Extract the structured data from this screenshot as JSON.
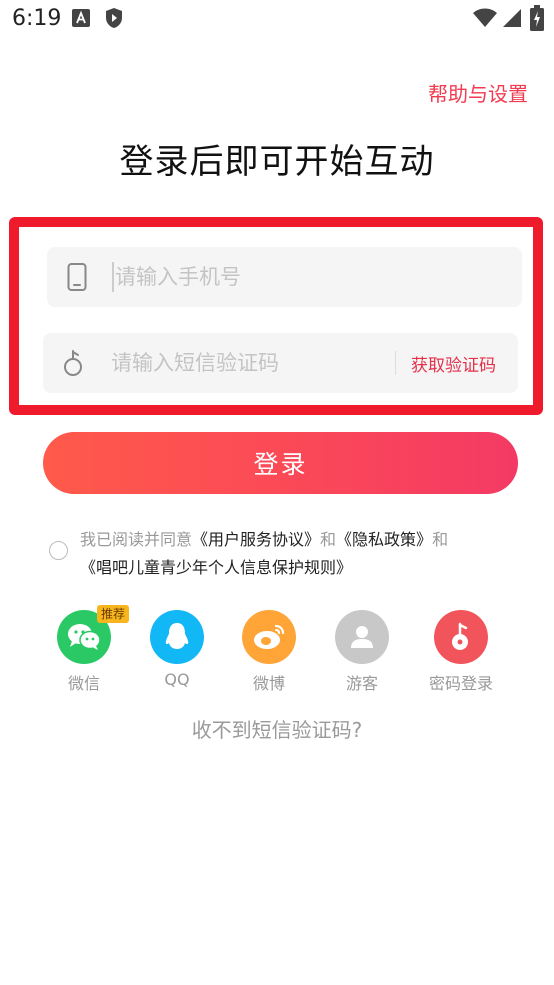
{
  "status_bar": {
    "time": "6:19"
  },
  "header": {
    "help_link": "帮助与设置",
    "title": "登录后即可开始互动"
  },
  "form": {
    "phone_placeholder": "请输入手机号",
    "code_placeholder": "请输入短信验证码",
    "get_code_label": "获取验证码",
    "login_label": "登录"
  },
  "agreement": {
    "prefix": "我已阅读并同意",
    "user_agreement": "《用户服务协议》",
    "and1": "和",
    "privacy_policy": "《隐私政策》",
    "and2": "和",
    "child_rules": "《唱吧儿童青少年个人信息保护规则》"
  },
  "social": {
    "items": [
      {
        "label": "微信",
        "icon": "wechat-icon",
        "color": "#2bc965",
        "badge": "推荐"
      },
      {
        "label": "QQ",
        "icon": "qq-icon",
        "color": "#12b7f5"
      },
      {
        "label": "微博",
        "icon": "weibo-icon",
        "color": "#ffa436"
      },
      {
        "label": "游客",
        "icon": "guest-icon",
        "color": "#c8c8c8"
      },
      {
        "label": "密码登录",
        "icon": "password-login-icon",
        "color": "#f2545b"
      }
    ]
  },
  "footer": {
    "no_sms_link": "收不到短信验证码?"
  },
  "colors": {
    "accent": "#f23a50",
    "highlight_border": "#ef1b2c"
  }
}
